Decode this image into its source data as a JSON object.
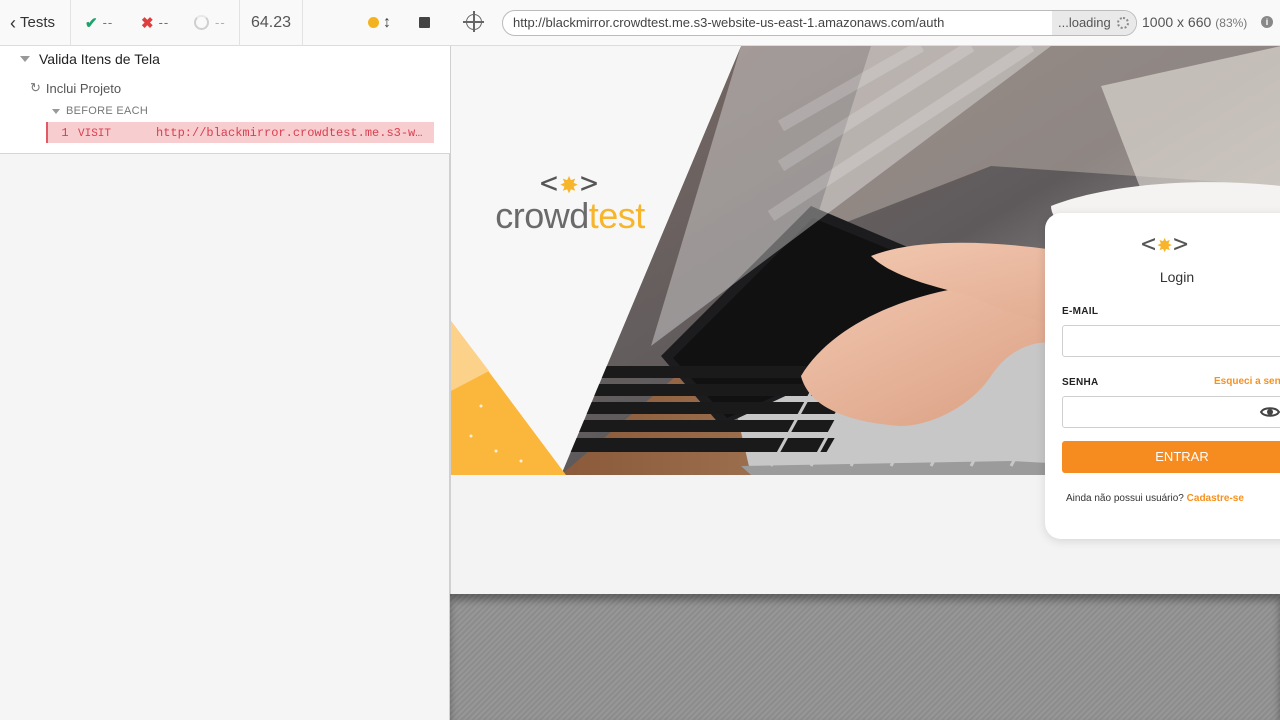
{
  "reporter": {
    "back_label": "Tests",
    "passed": "--",
    "failed": "--",
    "pending": "--",
    "duration": "64.23",
    "suite_title": "Valida Itens de Tela",
    "test_title": "Inclui Projeto",
    "hook_label": "BEFORE EACH",
    "command": {
      "number": "1",
      "name": "VISIT",
      "message": "http://blackmirror.crowdtest.me.s3-w…"
    },
    "colors": {
      "passed": "#1ea36d",
      "failed": "#e03d3d",
      "running": "#f3b320",
      "command_bg": "#f7cdd0"
    }
  },
  "aut": {
    "url": "http://blackmirror.crowdtest.me.s3-website-us-east-1.amazonaws.com/auth",
    "loading_label": "...loading",
    "viewport_size": "1000 x 660",
    "zoom": "(83%)"
  },
  "page": {
    "brand": {
      "prefix": "crowd",
      "suffix": "test",
      "accent": "#f7b52c"
    },
    "login": {
      "title": "Login",
      "email_label": "E-MAIL",
      "email_value": "",
      "password_label": "SENHA",
      "password_value": "",
      "forgot_label": "Esqueci a senha",
      "submit_label": "ENTRAR",
      "signup_prompt": "Ainda não possui usuário?",
      "signup_link": "Cadastre-se",
      "accent": "#f68b1f"
    }
  }
}
